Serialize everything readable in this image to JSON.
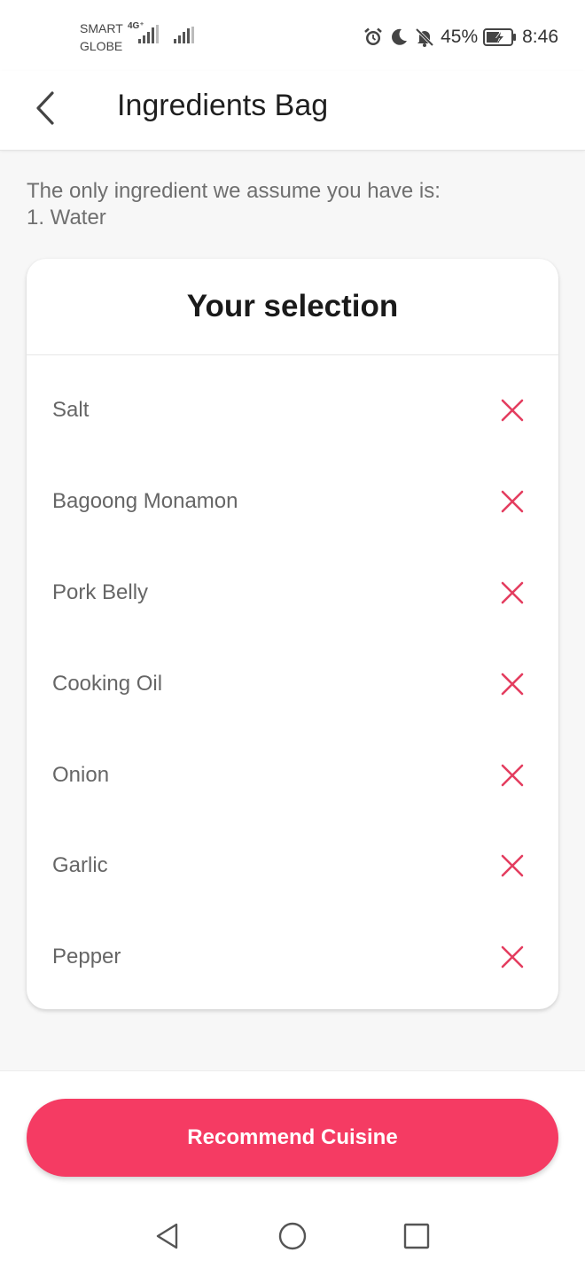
{
  "status_bar": {
    "carrier_top": "SMART",
    "carrier_bottom": "GLOBE",
    "network": "4G⁺",
    "battery": "45%",
    "time": "8:46",
    "icons": [
      "alarm-icon",
      "moon-icon",
      "bell-off-icon",
      "battery-charging-icon"
    ]
  },
  "header": {
    "title": "Ingredients Bag",
    "back_icon": "chevron-left-icon"
  },
  "note": {
    "line1": "The only ingredient we assume you have is:",
    "line2": "1. Water"
  },
  "selection": {
    "title": "Your selection",
    "remove_icon": "close-icon",
    "items": [
      {
        "label": "Salt"
      },
      {
        "label": "Bagoong Monamon"
      },
      {
        "label": "Pork Belly"
      },
      {
        "label": "Cooking Oil"
      },
      {
        "label": "Onion"
      },
      {
        "label": "Garlic"
      },
      {
        "label": "Pepper"
      }
    ]
  },
  "action": {
    "label": "Recommend Cuisine"
  },
  "colors": {
    "accent": "#f53b63",
    "remove_icon": "#e43d5f",
    "text_muted": "#666666"
  },
  "nav": {
    "icons": [
      "back-triangle-icon",
      "home-circle-icon",
      "recents-square-icon"
    ]
  }
}
